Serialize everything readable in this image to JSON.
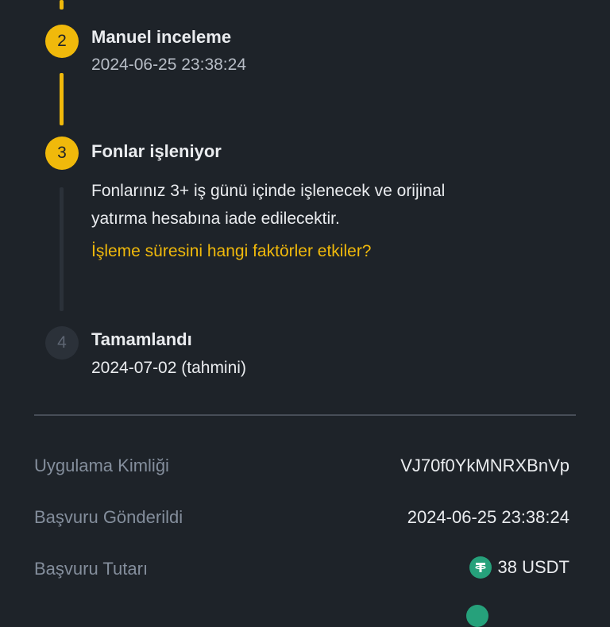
{
  "timeline": {
    "steps": [
      {
        "number": "2",
        "title": "Manuel inceleme",
        "subtitle": "2024-06-25 23:38:24"
      },
      {
        "number": "3",
        "title": "Fonlar işleniyor",
        "description_line1": "Fonlarınız 3+ iş günü içinde işlenecek ve orijinal",
        "description_line2": "yatırma hesabına iade edilecektir.",
        "link": "İşleme süresini hangi faktörler etkiler?"
      },
      {
        "number": "4",
        "title": "Tamamlandı",
        "subtitle": "2024-07-02 (tahmini)"
      }
    ]
  },
  "details": [
    {
      "label": "Uygulama Kimliği",
      "value": "VJ70f0YkMNRXBnVp"
    },
    {
      "label": "Başvuru Gönderildi",
      "value": "2024-06-25 23:38:24"
    },
    {
      "label": "Başvuru Tutarı",
      "value": "38 USDT",
      "icon": "usdt-icon"
    }
  ],
  "colors": {
    "accent": "#f0b90b",
    "background": "#1e2329",
    "muted": "#848e9c",
    "usdt": "#26a17b"
  }
}
